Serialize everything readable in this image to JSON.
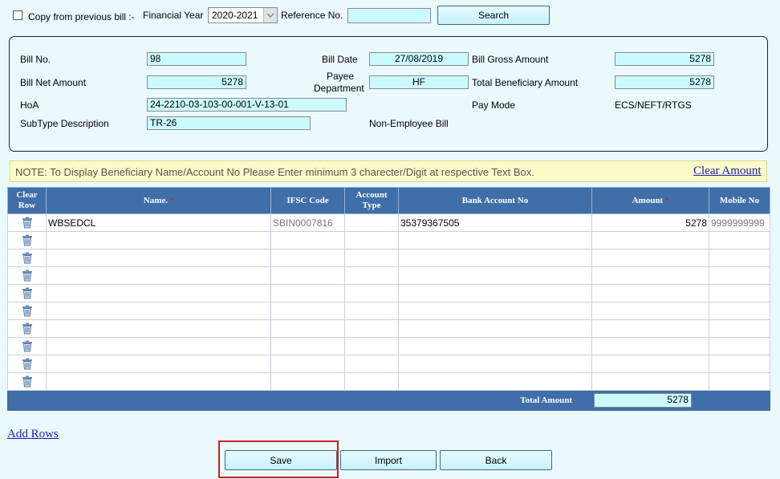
{
  "top_bar": {
    "copy_label": "Copy from previous bill :-",
    "financial_year_label": "Financial Year",
    "financial_year_value": "2020-2021",
    "reference_label": "Reference No.",
    "reference_value": "",
    "search_button": "Search"
  },
  "bill": {
    "bill_no_label": "Bill No.",
    "bill_no": "98",
    "bill_date_label": "Bill Date",
    "bill_date": "27/08/2019",
    "gross_label": "Bill Gross Amount",
    "gross": "5278",
    "net_label": "Bill Net Amount",
    "net": "5278",
    "payee_label_1": "Payee",
    "payee_label_2": "Department",
    "payee": "HF",
    "total_beneficiary_label": "Total Beneficiary Amount",
    "total_beneficiary": "5278",
    "hoa_label": "HoA",
    "hoa": "24-2210-03-103-00-001-V-13-01",
    "pay_mode_label": "Pay Mode",
    "pay_mode": "ECS/NEFT/RTGS",
    "subtype_label": "SubType Description",
    "subtype": "TR-26",
    "non_employee": "Non-Employee Bill"
  },
  "note": {
    "text": "NOTE: To Display Beneficiary Name/Account No Please Enter minimum 3 charecter/Digit at respective Text Box.",
    "clear_amount": "Clear Amount"
  },
  "grid": {
    "headers": {
      "clear_1": "Clear",
      "clear_2": "Row",
      "name": "Name.",
      "ifsc": "IFSC Code",
      "account_type_1": "Account",
      "account_type_2": "Type",
      "bank_account": "Bank Account No",
      "amount": "Amount",
      "mobile": "Mobile No"
    },
    "required_mark": "*",
    "rows": [
      {
        "name": "WBSEDCL",
        "ifsc": "SBIN0007816",
        "account_type": "",
        "bank_account": "35379367505",
        "amount": "5278",
        "mobile": "9999999999"
      },
      {
        "name": "",
        "ifsc": "",
        "account_type": "",
        "bank_account": "",
        "amount": "",
        "mobile": ""
      },
      {
        "name": "",
        "ifsc": "",
        "account_type": "",
        "bank_account": "",
        "amount": "",
        "mobile": ""
      },
      {
        "name": "",
        "ifsc": "",
        "account_type": "",
        "bank_account": "",
        "amount": "",
        "mobile": ""
      },
      {
        "name": "",
        "ifsc": "",
        "account_type": "",
        "bank_account": "",
        "amount": "",
        "mobile": ""
      },
      {
        "name": "",
        "ifsc": "",
        "account_type": "",
        "bank_account": "",
        "amount": "",
        "mobile": ""
      },
      {
        "name": "",
        "ifsc": "",
        "account_type": "",
        "bank_account": "",
        "amount": "",
        "mobile": ""
      },
      {
        "name": "",
        "ifsc": "",
        "account_type": "",
        "bank_account": "",
        "amount": "",
        "mobile": ""
      },
      {
        "name": "",
        "ifsc": "",
        "account_type": "",
        "bank_account": "",
        "amount": "",
        "mobile": ""
      },
      {
        "name": "",
        "ifsc": "",
        "account_type": "",
        "bank_account": "",
        "amount": "",
        "mobile": ""
      }
    ],
    "total_label": "Total Amount",
    "total_value": "5278"
  },
  "actions": {
    "add_rows": "Add Rows",
    "save": "Save",
    "import": "Import",
    "back": "Back"
  },
  "icons": {
    "row_delete": "trash-icon",
    "dropdown": "chevron-down-icon"
  },
  "colors": {
    "header_blue": "#3f6ea8",
    "field_cyan": "#ccfbff",
    "highlight_red": "#cc1f1f"
  }
}
